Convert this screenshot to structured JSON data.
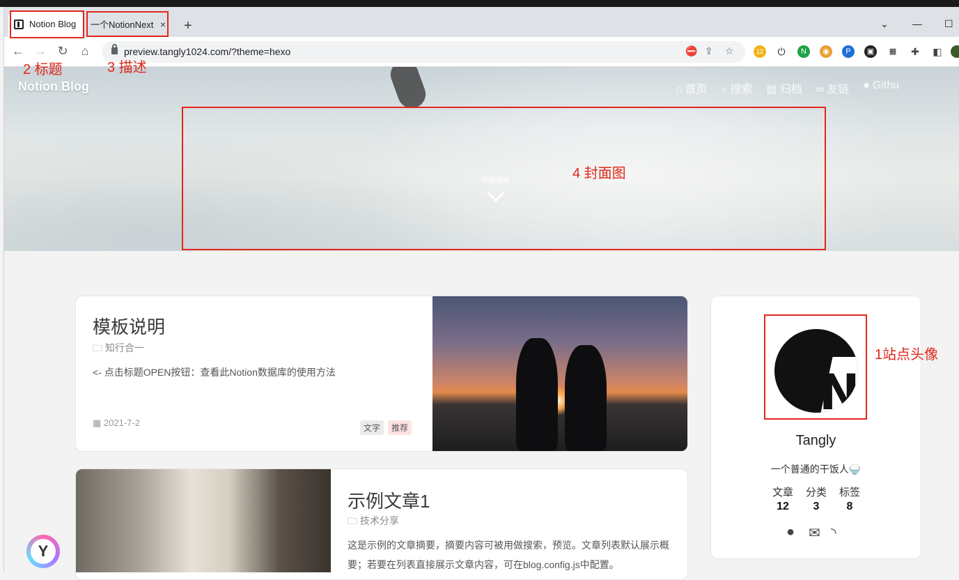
{
  "browser": {
    "tabs": [
      {
        "label": "Notion Blog"
      },
      {
        "label": "一个NotionNext"
      }
    ],
    "new_tab_symbol": "+",
    "close_symbol": "×",
    "url": "preview.tangly1024.com/?theme=hexo",
    "ext_badge": "12"
  },
  "header": {
    "site_title": "Notion Blog",
    "menu": [
      {
        "icon": "home-icon",
        "label": "首页"
      },
      {
        "icon": "search-icon",
        "label": "搜索"
      },
      {
        "icon": "archive-icon",
        "label": "归档"
      },
      {
        "icon": "link-icon",
        "label": "友链"
      },
      {
        "icon": "github-icon",
        "label": "Githu"
      }
    ],
    "start_reading": "开始阅读"
  },
  "annotations": {
    "avatar": "1站点头像",
    "title": "2 标题",
    "description": "3 描述",
    "cover": "4 封面图"
  },
  "posts": [
    {
      "title": "模板说明",
      "category": "知行合一",
      "summary": "<- 点击标题OPEN按钮：查看此Notion数据库的使用方法",
      "date": "2021-7-2",
      "tags": [
        "文字",
        "推荐"
      ]
    },
    {
      "title": "示例文章1",
      "category": "技术分享",
      "summary_line1": "这是示例的文章摘要，摘要内容可被用做搜索，预览。文章列表默认展示概",
      "summary_line2": "要；若要在列表直接展示文章内容，可在blog.config.js中配置。"
    }
  ],
  "profile": {
    "name": "Tangly",
    "description": "一个普通的干饭人🍚",
    "stats": [
      {
        "label": "文章",
        "value": "12"
      },
      {
        "label": "分类",
        "value": "3"
      },
      {
        "label": "标签",
        "value": "8"
      }
    ],
    "social_icons": [
      "github-icon",
      "mail-icon",
      "rss-icon"
    ]
  },
  "colors": {
    "annotation": "#e0271b",
    "tag_text_bg": "#ebebeb",
    "tag_recommend_bg": "#fde3e3"
  }
}
